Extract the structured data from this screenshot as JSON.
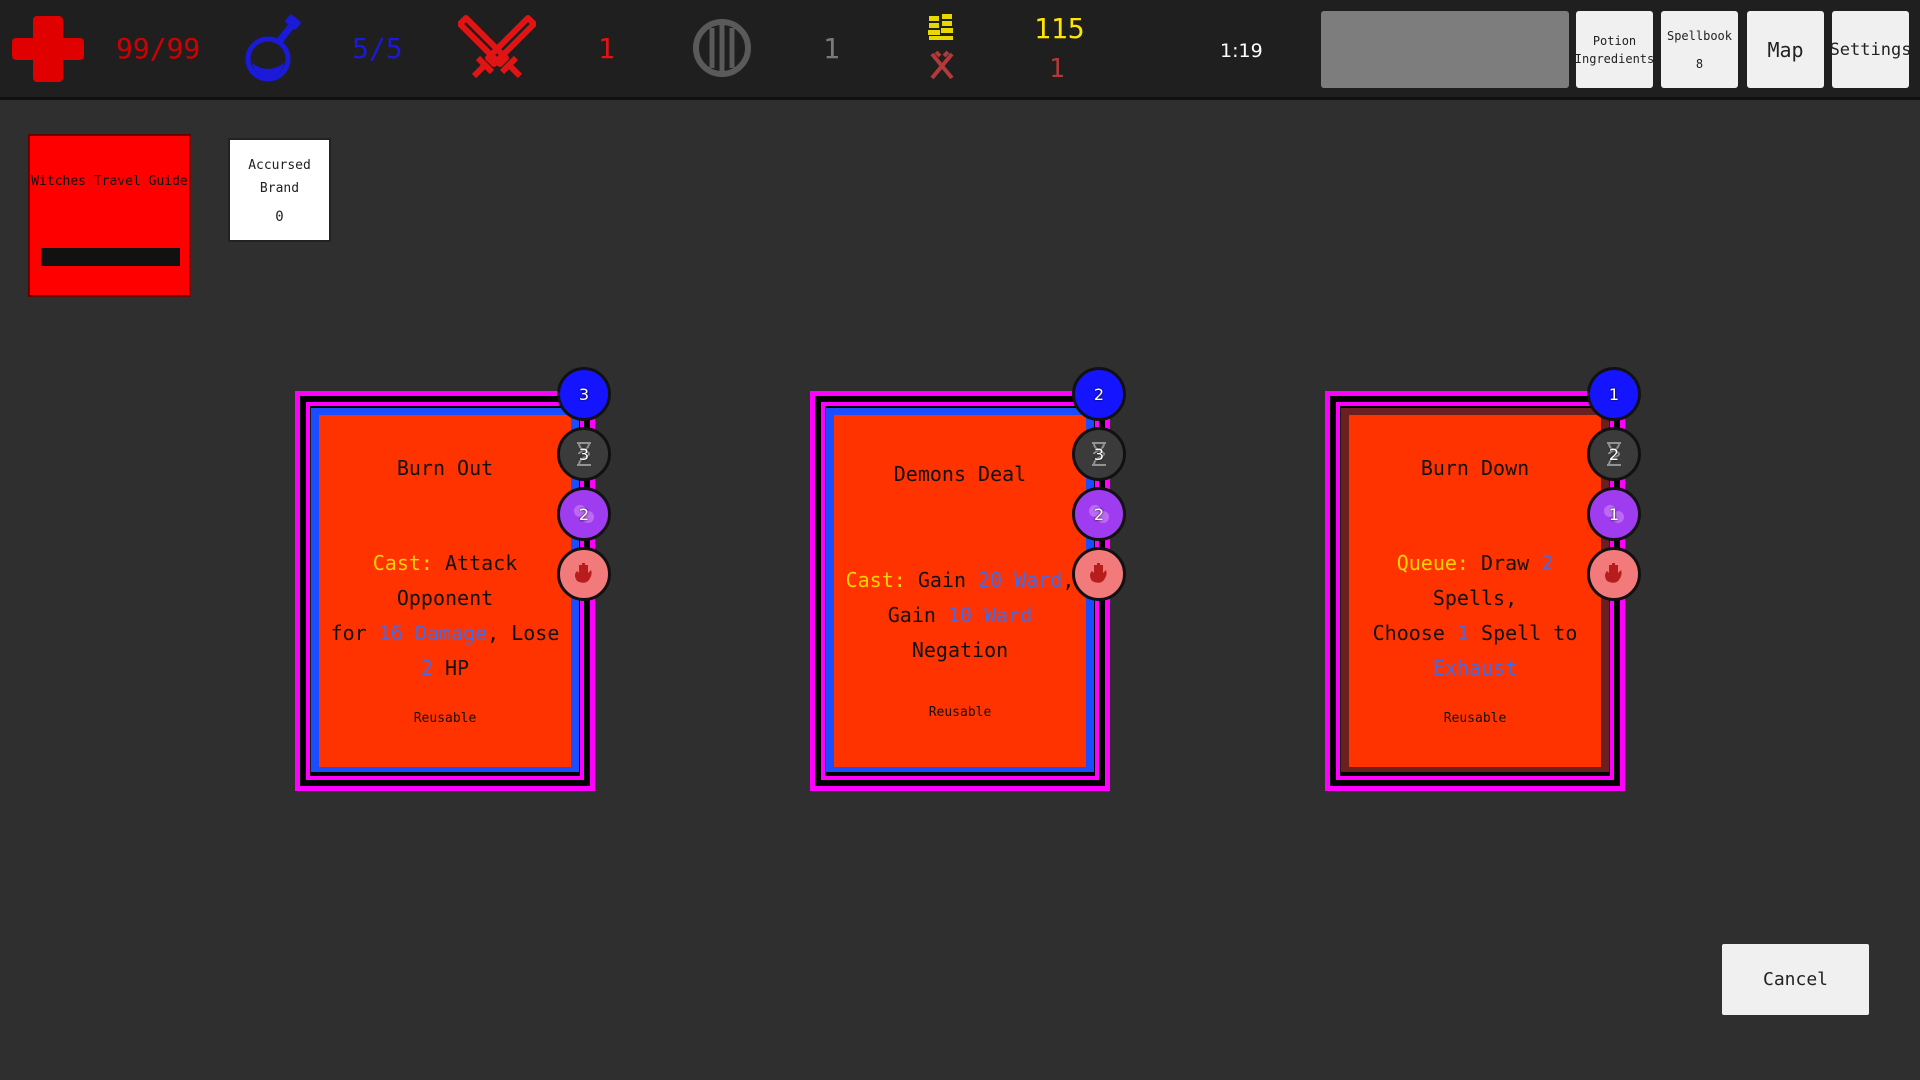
{
  "hud": {
    "hp": "99/99",
    "mana": "5/5",
    "attack": "1",
    "shield": "1",
    "gold": "115",
    "curse": "1",
    "timer": "1:19"
  },
  "top_buttons": {
    "potion_line1": "Potion",
    "potion_line2": "Ingredients",
    "spellbook_label": "Spellbook",
    "spellbook_count": "8",
    "map": "Map",
    "settings": "Settings"
  },
  "relics": {
    "travel_guide": "Witches Travel Guide",
    "brand_line1": "Accursed",
    "brand_line2": "Brand",
    "brand_count": "0"
  },
  "cards": [
    {
      "title": "Burn Out",
      "keyword": "Cast:",
      "line1_rest": " Attack Opponent",
      "line2_pre": "for ",
      "line2_num": "16 Damage",
      "line2_post": ", Lose",
      "line3_num": "2",
      "line3_post": " HP",
      "footer": "Reusable",
      "mana": "3",
      "time": "3",
      "charge": "2",
      "frame_color": "#1a4dff"
    },
    {
      "title": "Demons Deal",
      "keyword": "Cast:",
      "line1_rest": " Gain ",
      "line1_num": "20 Ward",
      "line1_post": ",",
      "line2_pre": "Gain ",
      "line2_num": "10 Ward",
      "line2_post": " Negation",
      "footer": "Reusable",
      "mana": "2",
      "time": "3",
      "charge": "2",
      "frame_color": "#1a4dff"
    },
    {
      "title": "Burn Down",
      "keyword": "Queue:",
      "line1_rest": " Draw ",
      "line1_num": "2",
      "line1_post": " Spells,",
      "line2_pre": "Choose ",
      "line2_num": "1",
      "line2_post": " Spell to",
      "line3_num": "Exhaust",
      "footer": "Reusable",
      "mana": "1",
      "time": "2",
      "charge": "1",
      "frame_color": "#6b2020"
    }
  ],
  "cancel": "Cancel",
  "colors": {
    "hp": "#d10000",
    "mana": "#1a1ad8",
    "attack": "#e11414",
    "gold": "#ffe600",
    "card_face": "#ff3300",
    "card_border": "#ff00ff",
    "keyword": "#ffd400",
    "number": "#3a6df0"
  }
}
